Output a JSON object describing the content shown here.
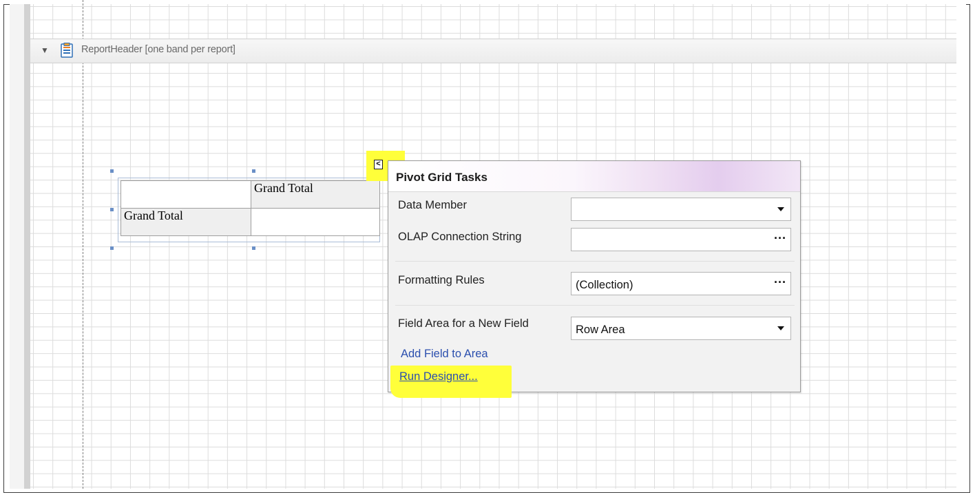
{
  "band": {
    "label": "ReportHeader [one band per report]",
    "expanded_glyph": "▼",
    "icon": "report-header-icon"
  },
  "pivot_grid": {
    "column_header": "Grand Total",
    "row_header": "Grand Total"
  },
  "smart_tag": {
    "glyph": "<",
    "highlight_color": "#ffff3a"
  },
  "task_panel": {
    "title": "Pivot Grid Tasks",
    "rows": [
      {
        "label": "Data Member",
        "value": "",
        "editor": "dropdown"
      },
      {
        "label": "OLAP Connection String",
        "value": "",
        "editor": "ellipsis"
      },
      {
        "label": "Formatting Rules",
        "value": "(Collection)",
        "editor": "ellipsis"
      },
      {
        "label": "Field Area for a New Field",
        "value": "Row Area",
        "editor": "dropdown"
      }
    ],
    "ellipsis_glyph": "···",
    "links": {
      "add_field": "Add Field to Area",
      "run_designer": "Run Designer..."
    }
  },
  "colors": {
    "link": "#2b4fae",
    "highlight": "#ffff3a",
    "selection_handle": "#6a8fc6"
  }
}
